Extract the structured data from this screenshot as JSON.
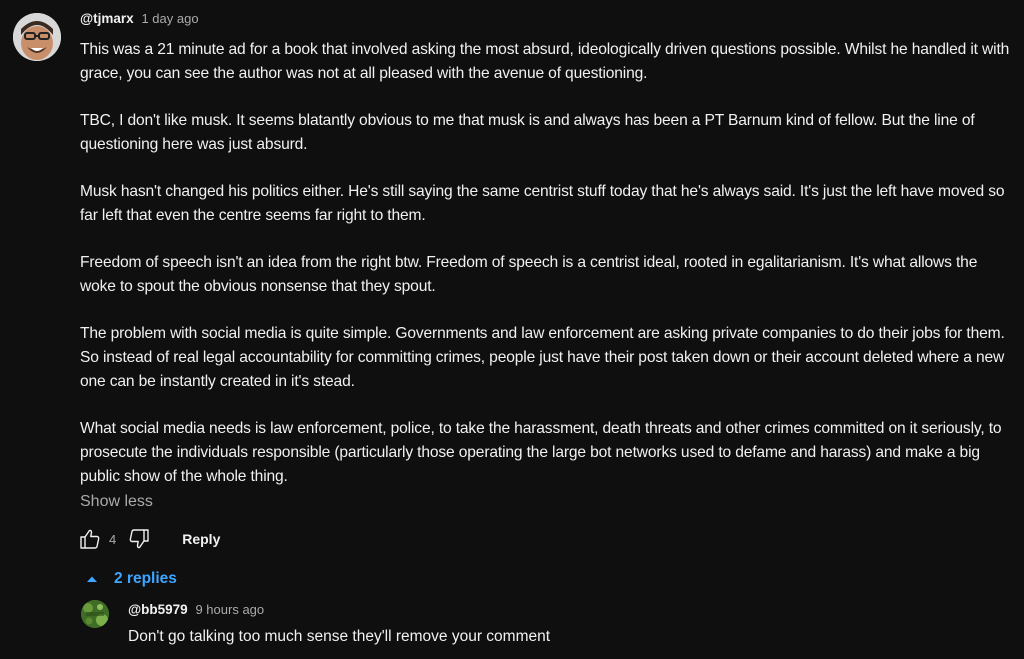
{
  "comment": {
    "author": "@tjmarx",
    "time": "1 day ago",
    "paragraphs": [
      "This was a 21 minute ad for a book that involved asking the most absurd, ideologically driven questions possible. Whilst he handled it with grace, you can see the author was not at all pleased with the avenue of questioning.",
      "TBC, I don't like musk. It seems blatantly obvious to me that musk is and always has been a PT Barnum kind of fellow. But the line of questioning here was just absurd.",
      "Musk hasn't changed his politics either. He's still saying the same centrist stuff today that he's always said. It's just the left have moved so far left that even the centre seems far right to them.",
      "Freedom of speech isn't an idea from the right btw. Freedom of speech is a centrist ideal, rooted in egalitarianism. It's what allows the woke to spout the obvious nonsense that they spout.",
      "The problem with social media is quite simple. Governments and law enforcement are asking private companies to do their jobs for them. So instead of real legal accountability for committing crimes, people just have their post taken down or their account deleted where a new one can be instantly created in it's stead.",
      "What social media needs is law enforcement, police, to take the harassment, death threats and other crimes committed on it seriously, to prosecute the individuals responsible (particularly those operating the large bot networks used to defame and harass) and make a big public show of the whole thing."
    ],
    "show_less": "Show less",
    "like_count": "4",
    "reply_label": "Reply"
  },
  "replies": {
    "toggle_label": "2 replies",
    "items": [
      {
        "author": "@bb5979",
        "time": "9 hours ago",
        "text": "Don't go talking too much sense they'll remove your comment"
      }
    ]
  },
  "colors": {
    "background": "#0f0f0f",
    "text": "#f1f1f1",
    "secondary_text": "#aaaaaa",
    "link_blue": "#3ea6ff"
  },
  "icons": {
    "like": "thumbs-up-icon",
    "dislike": "thumbs-down-icon",
    "expand": "caret-up-icon"
  }
}
